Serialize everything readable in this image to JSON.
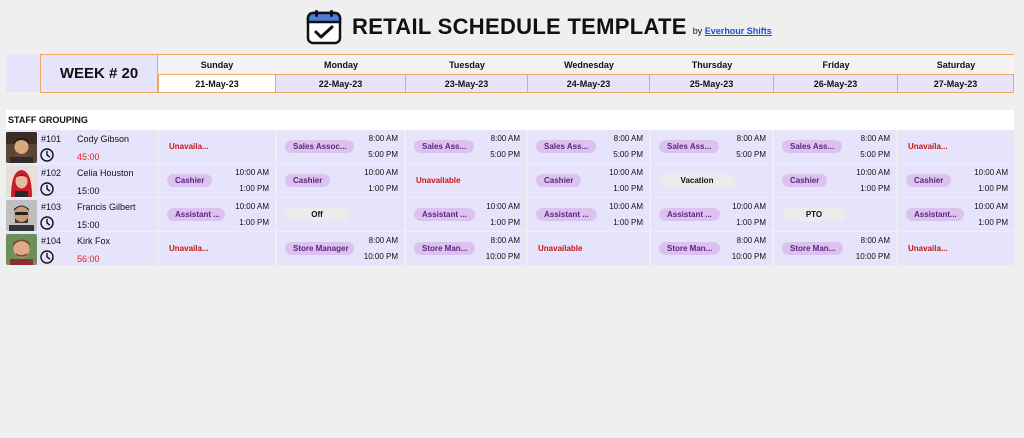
{
  "header": {
    "title": "RETAIL SCHEDULE TEMPLATE",
    "by_prefix": "by",
    "by_link": "Everhour Shifts",
    "icon": "calendar-check-icon",
    "accent": "#4a7fe0"
  },
  "week": {
    "label": "WEEK # 20"
  },
  "days": [
    {
      "name": "Sunday",
      "date": "21-May-23"
    },
    {
      "name": "Monday",
      "date": "22-May-23"
    },
    {
      "name": "Tuesday",
      "date": "23-May-23"
    },
    {
      "name": "Wednesday",
      "date": "24-May-23"
    },
    {
      "name": "Thursday",
      "date": "25-May-23"
    },
    {
      "name": "Friday",
      "date": "26-May-23"
    },
    {
      "name": "Saturday",
      "date": "27-May-23"
    }
  ],
  "grouping": {
    "label": "STAFF GROUPING"
  },
  "colors": {
    "lavender": "#e6e4fa",
    "pill": "#dcc3ef",
    "pill_text": "#5a2580",
    "unavailable": "#c81414",
    "overtime": "#e02020",
    "border": "#f0a763"
  },
  "staff": [
    {
      "id": "#101",
      "name": "Cody Gibson",
      "hours": "45:00",
      "hours_alert": true,
      "shifts": [
        {
          "type": "unavailable",
          "label": "Unavaila..."
        },
        {
          "type": "role",
          "label": "Sales Assoc...",
          "start": "8:00 AM",
          "end": "5:00 PM"
        },
        {
          "type": "role",
          "label": "Sales Ass...",
          "start": "8:00 AM",
          "end": "5:00 PM"
        },
        {
          "type": "role",
          "label": "Sales Ass...",
          "start": "8:00 AM",
          "end": "5:00 PM"
        },
        {
          "type": "role",
          "label": "Sales Ass...",
          "start": "8:00 AM",
          "end": "5:00 PM"
        },
        {
          "type": "role",
          "label": "Sales Ass...",
          "start": "8:00 AM",
          "end": "5:00 PM"
        },
        {
          "type": "unavailable",
          "label": "Unavaila..."
        }
      ]
    },
    {
      "id": "#102",
      "name": "Celia Houston",
      "hours": "15:00",
      "hours_alert": false,
      "shifts": [
        {
          "type": "role",
          "label": "Cashier",
          "start": "10:00 AM",
          "end": "1:00 PM"
        },
        {
          "type": "role",
          "label": "Cashier",
          "start": "10:00 AM",
          "end": "1:00 PM"
        },
        {
          "type": "unavailable",
          "label": "Unavailable"
        },
        {
          "type": "role",
          "label": "Cashier",
          "start": "10:00 AM",
          "end": "1:00 PM"
        },
        {
          "type": "status",
          "label": "Vacation"
        },
        {
          "type": "role",
          "label": "Cashier",
          "start": "10:00 AM",
          "end": "1:00 PM"
        },
        {
          "type": "role",
          "label": "Cashier",
          "start": "10:00 AM",
          "end": "1:00 PM"
        }
      ]
    },
    {
      "id": "#103",
      "name": "Francis Gilbert",
      "hours": "15:00",
      "hours_alert": false,
      "shifts": [
        {
          "type": "role",
          "label": "Assistant ...",
          "start": "10:00 AM",
          "end": "1:00 PM"
        },
        {
          "type": "status",
          "label": "Off"
        },
        {
          "type": "role",
          "label": "Assistant ...",
          "start": "10:00 AM",
          "end": "1:00 PM"
        },
        {
          "type": "role",
          "label": "Assistant ...",
          "start": "10:00 AM",
          "end": "1:00 PM"
        },
        {
          "type": "role",
          "label": "Assistant ...",
          "start": "10:00 AM",
          "end": "1:00 PM"
        },
        {
          "type": "status",
          "label": "PTO"
        },
        {
          "type": "role",
          "label": "Assistant...",
          "start": "10:00 AM",
          "end": "1:00 PM"
        }
      ]
    },
    {
      "id": "#104",
      "name": "Kirk Fox",
      "hours": "56:00",
      "hours_alert": true,
      "shifts": [
        {
          "type": "unavailable",
          "label": "Unavaila..."
        },
        {
          "type": "role",
          "label": "Store Manager",
          "start": "8:00 AM",
          "end": "10:00 PM"
        },
        {
          "type": "role",
          "label": "Store Man...",
          "start": "8:00 AM",
          "end": "10:00 PM"
        },
        {
          "type": "unavailable",
          "label": "Unavailable"
        },
        {
          "type": "role",
          "label": "Store Man...",
          "start": "8:00 AM",
          "end": "10:00 PM"
        },
        {
          "type": "role",
          "label": "Store Man...",
          "start": "8:00 AM",
          "end": "10:00 PM"
        },
        {
          "type": "unavailable",
          "label": "Unavaila..."
        }
      ]
    }
  ]
}
